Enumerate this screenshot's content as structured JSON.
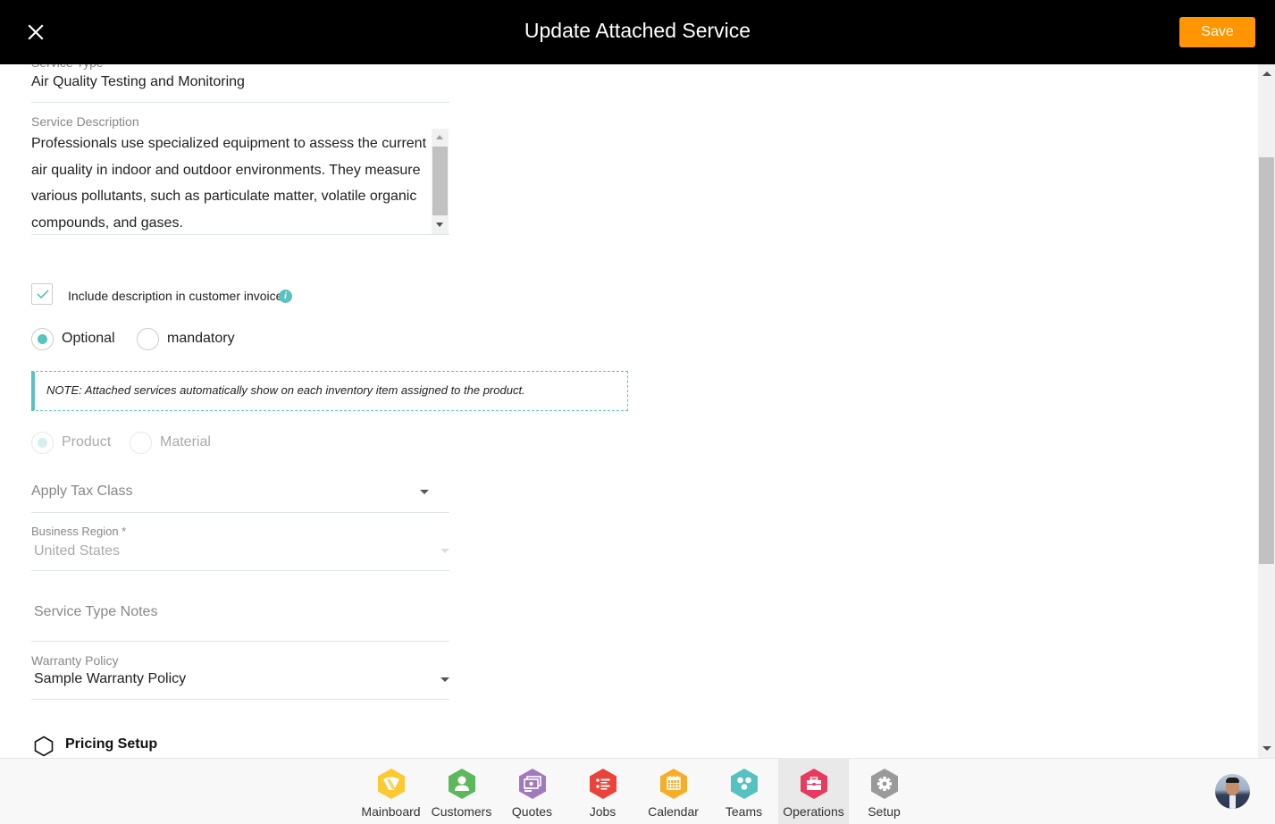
{
  "header": {
    "title": "Update Attached Service",
    "save_label": "Save",
    "close_icon": "close-icon"
  },
  "form": {
    "service_type": {
      "label": "Service Type",
      "value": "Air Quality Testing and Monitoring"
    },
    "service_description": {
      "label": "Service Description",
      "value": "Professionals use specialized equipment to assess the current air quality in indoor and outdoor environments. They measure various pollutants, such as particulate matter, volatile organic compounds, and gases."
    },
    "include_description": {
      "label": "Include description in customer invoice",
      "checked": true,
      "info_icon": "info-icon"
    },
    "requirement": {
      "options": [
        {
          "label": "Optional",
          "selected": true
        },
        {
          "label": "mandatory",
          "selected": false
        }
      ]
    },
    "note": "NOTE: Attached services automatically show on each inventory item assigned to the product.",
    "item_type": {
      "disabled": true,
      "options": [
        {
          "label": "Product",
          "selected": true
        },
        {
          "label": "Material",
          "selected": false
        }
      ]
    },
    "tax_class": {
      "placeholder": "Apply Tax Class",
      "value": ""
    },
    "business_region": {
      "label": "Business Region *",
      "value": "United States",
      "disabled": true
    },
    "service_type_notes": {
      "placeholder": "Service Type Notes",
      "value": ""
    },
    "warranty_policy": {
      "label": "Warranty Policy",
      "value": "Sample Warranty Policy"
    },
    "pricing_setup": {
      "label": "Pricing Setup",
      "icon": "hexagon-outline-icon"
    }
  },
  "bottom_nav": {
    "items": [
      {
        "label": "Mainboard",
        "icon": "mainboard-icon",
        "color": "#fdc830",
        "active": false
      },
      {
        "label": "Customers",
        "icon": "customers-icon",
        "color": "#5cb85c",
        "active": false
      },
      {
        "label": "Quotes",
        "icon": "quotes-icon",
        "color": "#a17abd",
        "active": false
      },
      {
        "label": "Jobs",
        "icon": "jobs-icon",
        "color": "#ea4339",
        "active": false
      },
      {
        "label": "Calendar",
        "icon": "calendar-icon",
        "color": "#f7ae26",
        "active": false
      },
      {
        "label": "Teams",
        "icon": "teams-icon",
        "color": "#55c2c1",
        "active": false
      },
      {
        "label": "Operations",
        "icon": "operations-icon",
        "color": "#e83a5e",
        "active": true
      },
      {
        "label": "Setup",
        "icon": "setup-icon",
        "color": "#9a9a9a",
        "active": false
      }
    ],
    "avatar": "user-avatar"
  },
  "colors": {
    "accent": "#58c3c1",
    "save_button": "#ff9500",
    "header_bg": "#000000"
  }
}
